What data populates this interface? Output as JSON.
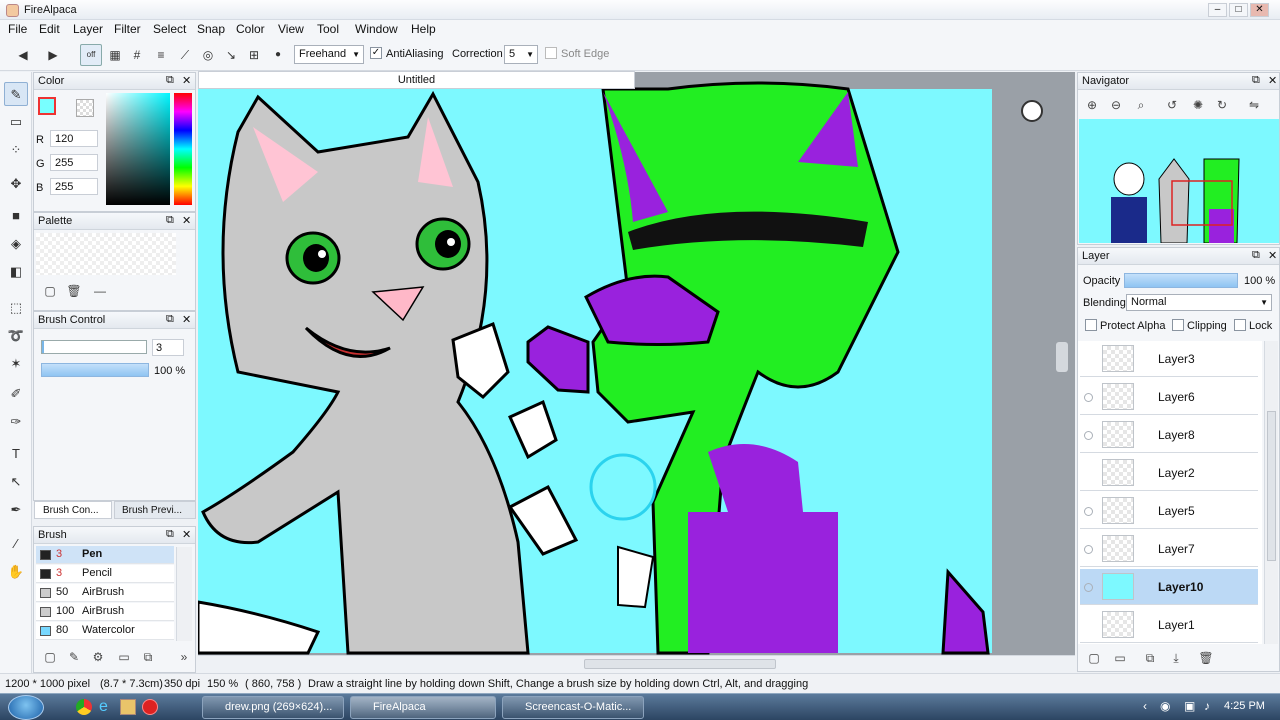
{
  "app": {
    "title": "FireAlpaca"
  },
  "window_controls": {
    "minimize": "–",
    "maximize": "□",
    "close": "✕"
  },
  "menu": [
    "File",
    "Edit",
    "Layer",
    "Filter",
    "Select",
    "Snap",
    "Color",
    "View",
    "Tool",
    "Window",
    "Help"
  ],
  "toolbar": {
    "mode": "Freehand",
    "antialiasing_label": "AntiAliasing",
    "antialiasing_checked": true,
    "correction_label": "Correction",
    "correction_value": "5",
    "soft_edge_label": "Soft Edge",
    "soft_edge_checked": false,
    "snap_off_label": "off"
  },
  "color_panel": {
    "title": "Color",
    "r_label": "R",
    "r": "120",
    "g_label": "G",
    "g": "255",
    "b_label": "B",
    "b": "255",
    "primary_color": "#78ffff"
  },
  "palette_panel": {
    "title": "Palette"
  },
  "brush_control": {
    "title": "Brush Control",
    "size": "3",
    "opacity": "100 %"
  },
  "brush_tabs": [
    "Brush Con...",
    "Brush Previ..."
  ],
  "brush_panel": {
    "title": "Brush",
    "items": [
      {
        "size": "3",
        "name": "Pen",
        "color": "#222222"
      },
      {
        "size": "3",
        "name": "Pencil",
        "color": "#222222"
      },
      {
        "size": "50",
        "name": "AirBrush",
        "color": "#cccccc"
      },
      {
        "size": "100",
        "name": "AirBrush",
        "color": "#cccccc"
      },
      {
        "size": "80",
        "name": "Watercolor",
        "color": "#78d8ff"
      }
    ]
  },
  "document": {
    "tab_title": "Untitled"
  },
  "navigator": {
    "title": "Navigator"
  },
  "layer_panel": {
    "title": "Layer",
    "opacity_label": "Opacity",
    "opacity_value": "100 %",
    "blending_label": "Blending",
    "blending_value": "Normal",
    "protect_alpha": "Protect Alpha",
    "clipping": "Clipping",
    "lock": "Lock",
    "layers": [
      "Layer3",
      "Layer6",
      "Layer8",
      "Layer2",
      "Layer5",
      "Layer7",
      "Layer10",
      "Layer1"
    ],
    "selected": "Layer10"
  },
  "status": {
    "size": "1200 * 1000 pixel",
    "physical": "(8.7 * 7.3cm)",
    "dpi": "350 dpi",
    "zoom": "150 %",
    "coords": "( 860, 758 )",
    "hint": "Draw a straight line by holding down Shift, Change a brush size by holding down Ctrl, Alt, and dragging"
  },
  "taskbar": {
    "items": [
      "drew.png (269×624)...",
      "FireAlpaca",
      "Screencast-O-Matic..."
    ],
    "time": "4:25 PM"
  },
  "colors": {
    "canvas_bg": "#7df9ff",
    "accent": "#3b7ec9",
    "green": "#22ee22",
    "purple": "#9922dd"
  }
}
